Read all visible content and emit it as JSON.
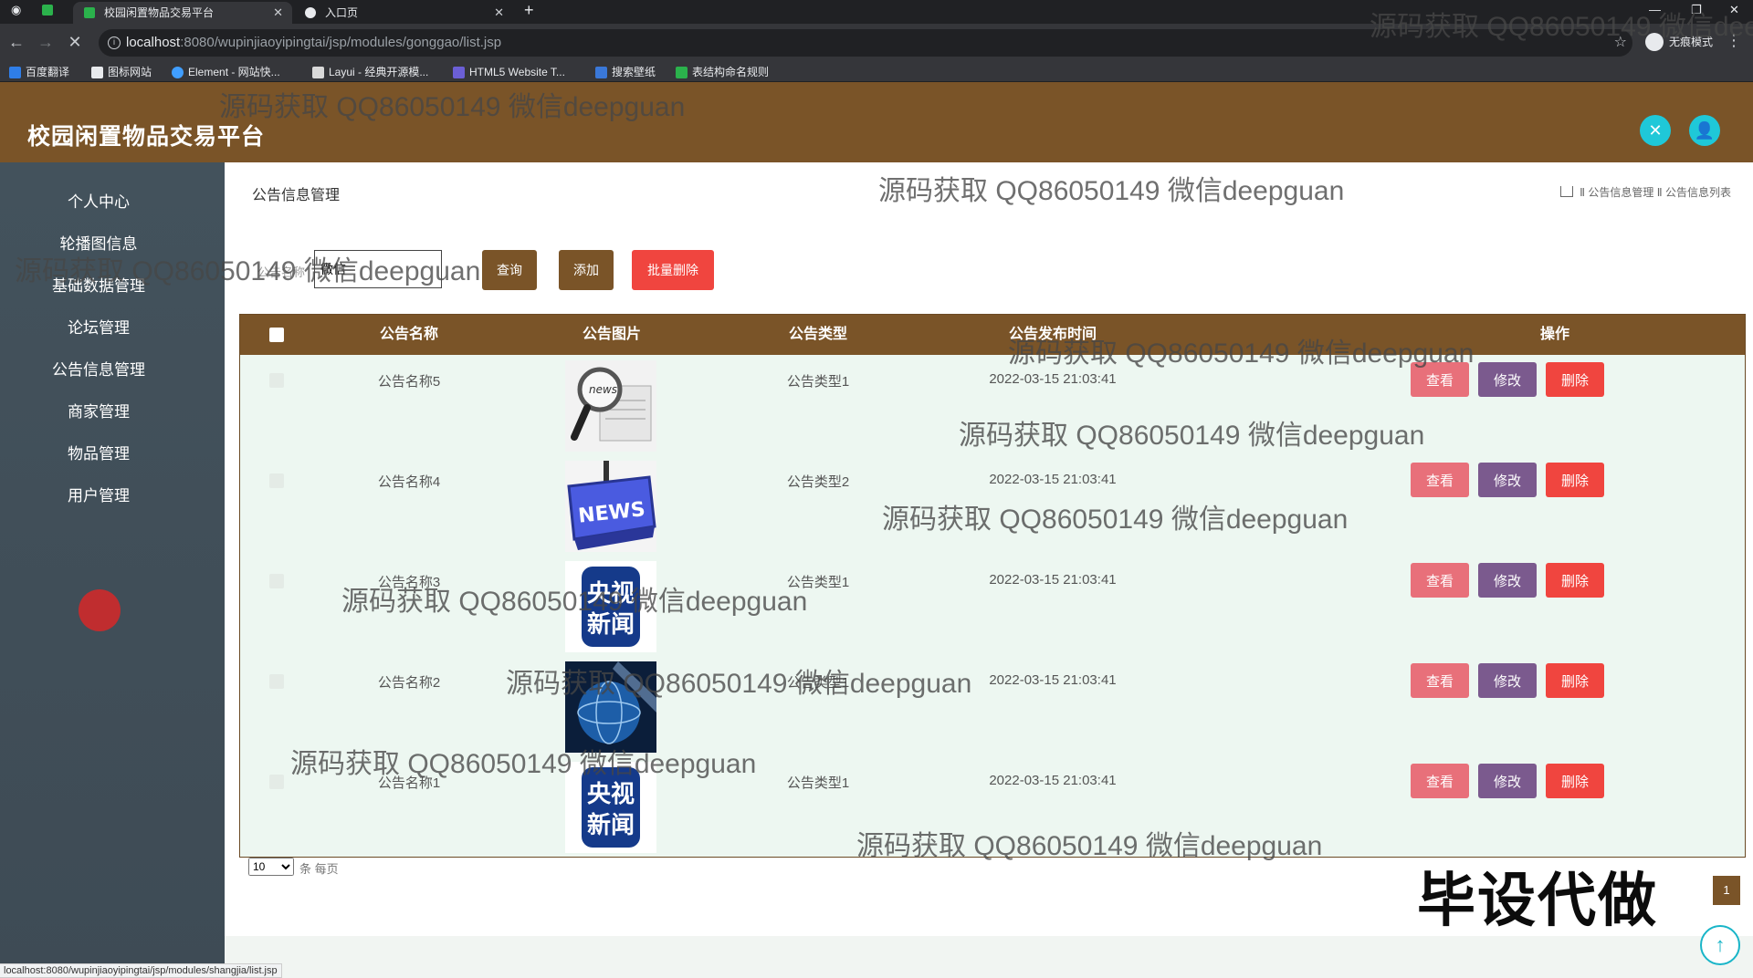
{
  "browser": {
    "tabs": [
      {
        "title": "校园闲置物品交易平台",
        "active": true
      },
      {
        "title": "入口页",
        "active": false
      }
    ],
    "url_host": "localhost",
    "url_path": ":8080/wupinjiaoyipingtai/jsp/modules/gonggao/list.jsp",
    "incognito_label": "无痕模式",
    "bookmarks": [
      "百度翻译",
      "图标网站",
      "Element - 网站快...",
      "Layui - 经典开源模...",
      "HTML5 Website T...",
      "搜索壁纸",
      "表结构命名规则"
    ]
  },
  "app": {
    "title": "校园闲置物品交易平台",
    "accent_color": "#7a5428"
  },
  "sidebar": {
    "items": [
      {
        "label": "个人中心"
      },
      {
        "label": "轮播图信息"
      },
      {
        "label": "基础数据管理"
      },
      {
        "label": "论坛管理"
      },
      {
        "label": "公告信息管理"
      },
      {
        "label": "商家管理"
      },
      {
        "label": "物品管理"
      },
      {
        "label": "用户管理"
      }
    ]
  },
  "main": {
    "page_title": "公告信息管理",
    "breadcrumb": [
      "公告信息管理",
      "公告信息列表"
    ],
    "search": {
      "label": "公告名称",
      "value": "微信"
    },
    "buttons": {
      "query": "查询",
      "add": "添加",
      "batch_delete": "批量删除"
    },
    "table": {
      "headers": [
        "公告名称",
        "公告图片",
        "公告类型",
        "公告发布时间",
        "操作"
      ],
      "rows": [
        {
          "name": "公告名称5",
          "image": "news-magnifier-image",
          "type": "公告类型1",
          "time": "2022-03-15 21:03:41"
        },
        {
          "name": "公告名称4",
          "image": "news-sign-image",
          "type": "公告类型2",
          "time": "2022-03-15 21:03:41"
        },
        {
          "name": "公告名称3",
          "image": "cctv-news-logo-image",
          "type": "公告类型1",
          "time": "2022-03-15 21:03:41"
        },
        {
          "name": "公告名称2",
          "image": "globe-image",
          "type": "公告类型1",
          "time": "2022-03-15 21:03:41"
        },
        {
          "name": "公告名称1",
          "image": "cctv-news-logo-image",
          "type": "公告类型1",
          "time": "2022-03-15 21:03:41"
        }
      ],
      "row_actions": {
        "view": "查看",
        "edit": "修改",
        "delete": "删除"
      }
    },
    "pager": {
      "page_size": "10",
      "unit": "条 每页",
      "current_page": "1"
    }
  },
  "statusbar": "localhost:8080/wupinjiaoyipingtai/jsp/modules/shangjia/list.jsp",
  "watermarks": {
    "repeated": "源码获取 QQ86050149 微信deepguan",
    "banner": "毕设代做"
  },
  "colors": {
    "view_button": "#e8707a",
    "edit_button": "#7b5a8e",
    "delete_button": "#f0453f",
    "query_button": "#7a5428",
    "add_button": "#7a5428",
    "batch_delete_button": "#f0453f"
  }
}
